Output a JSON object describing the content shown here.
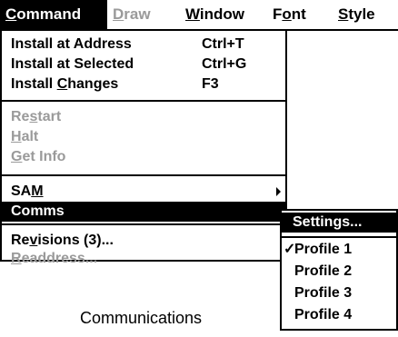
{
  "menubar": {
    "items": [
      {
        "pre": "",
        "u": "C",
        "post": "ommand"
      },
      {
        "pre": "",
        "u": "D",
        "post": "raw"
      },
      {
        "pre": "",
        "u": "W",
        "post": "indow"
      },
      {
        "pre": "F",
        "u": "o",
        "post": "nt"
      },
      {
        "pre": "",
        "u": "S",
        "post": "tyle"
      }
    ]
  },
  "command_menu": {
    "install_address": {
      "label_pre": "Install at Address",
      "accel": "Ctrl+T"
    },
    "install_selected": {
      "label_pre": "Install at Selected",
      "accel": "Ctrl+G"
    },
    "install_changes": {
      "label_pre": "Install ",
      "label_u": "C",
      "label_post": "hanges",
      "accel": "F3"
    },
    "restart": {
      "pre": "Re",
      "u": "s",
      "post": "tart"
    },
    "halt": {
      "pre": "",
      "u": "H",
      "post": "alt"
    },
    "get_info": {
      "pre": "",
      "u": "G",
      "post": "et Info"
    },
    "sam": {
      "pre": "SA",
      "u": "M",
      "post": ""
    },
    "comms": {
      "label": "Comms"
    },
    "revisions": {
      "pre": "Re",
      "u": "v",
      "post": "isions (3)..."
    },
    "readdress": {
      "pre": "",
      "u": "R",
      "post": "eaddress..."
    }
  },
  "comms_submenu": {
    "settings": "Settings...",
    "check_mark": "✓",
    "profiles": [
      "Profile 1",
      "Profile 2",
      "Profile 3",
      "Profile 4"
    ]
  },
  "caption": "Communications"
}
